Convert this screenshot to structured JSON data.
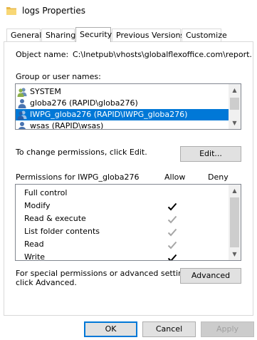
{
  "window": {
    "title": "logs Properties"
  },
  "tabs": [
    "General",
    "Sharing",
    "Security",
    "Previous Versions",
    "Customize"
  ],
  "object": {
    "label": "Object name:",
    "value": "C:\\Inetpub\\vhosts\\globalflexoffice.com\\report.thier"
  },
  "group_users": {
    "label": "Group or user names:",
    "items": [
      {
        "name": "SYSTEM",
        "selected": false
      },
      {
        "name": "globa276 (RAPID\\globa276)",
        "selected": false
      },
      {
        "name": "IWPG_globa276 (RAPID\\IWPG_globa276)",
        "selected": true
      },
      {
        "name": "wsas (RAPID\\wsas)",
        "selected": false
      }
    ]
  },
  "change_hint": "To change permissions, click Edit.",
  "edit_button": "Edit...",
  "permissions": {
    "header": "Permissions for IWPG_globa276",
    "allow_header": "Allow",
    "deny_header": "Deny",
    "rows": [
      {
        "name": "Full control",
        "allow": "none"
      },
      {
        "name": "Modify",
        "allow": "checked"
      },
      {
        "name": "Read & execute",
        "allow": "grayed"
      },
      {
        "name": "List folder contents",
        "allow": "grayed"
      },
      {
        "name": "Read",
        "allow": "grayed"
      },
      {
        "name": "Write",
        "allow": "checked"
      }
    ]
  },
  "special": {
    "line1": "For special permissions or advanced settings,",
    "line2": "click Advanced.",
    "button": "Advanced"
  },
  "footer": {
    "ok": "OK",
    "cancel": "Cancel",
    "apply": "Apply"
  },
  "colors": {
    "selection": "#0078d7",
    "check": "#000000",
    "check_grayed": "#a6a6a6"
  }
}
